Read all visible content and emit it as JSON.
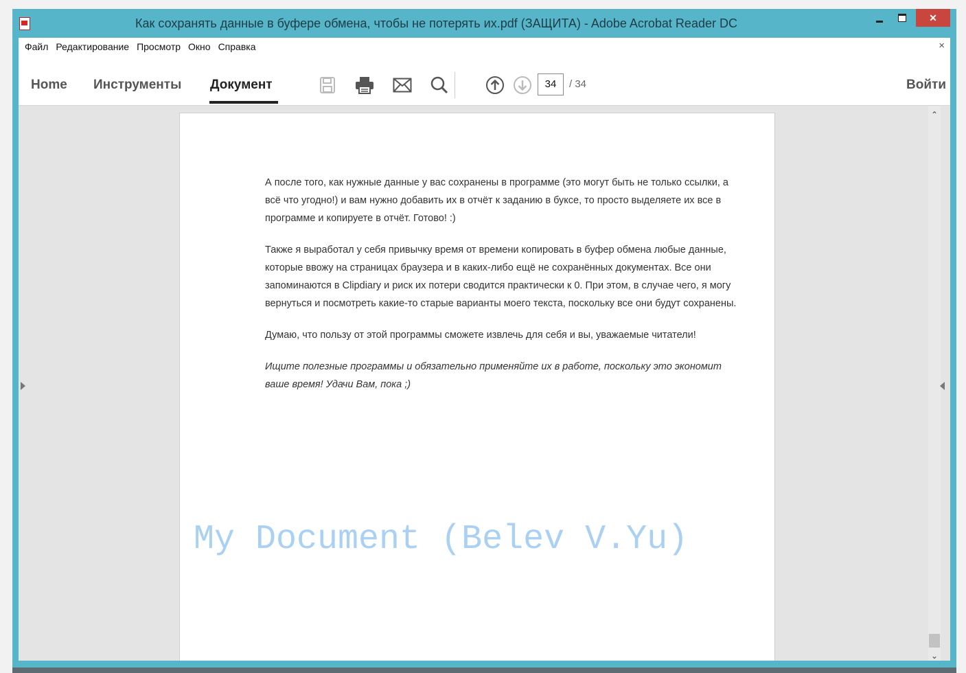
{
  "window": {
    "title": "Как сохранять данные в буфере обмена, чтобы не потерять их.pdf (ЗАЩИТА) - Adobe Acrobat Reader DC",
    "close_glyph": "✕"
  },
  "menu": {
    "items": [
      "Файл",
      "Редактирование",
      "Просмотр",
      "Окно",
      "Справка"
    ],
    "close_glyph": "×"
  },
  "toolbar": {
    "tabs": [
      "Home",
      "Инструменты",
      "Документ"
    ],
    "active_tab": "Документ",
    "tools": [
      "save-icon",
      "print-icon",
      "email-icon",
      "search-icon",
      "page-up-icon",
      "page-down-icon"
    ],
    "page_current": "34",
    "page_total": "/ 34",
    "login_label": "Войти"
  },
  "document": {
    "paragraphs": [
      "А после того, как нужные данные у вас сохранены в программе (это могут быть не только ссылки, а всё что угодно!) и вам нужно добавить их в отчёт к заданию в буксе, то просто выделяете их все в программе и копируете в отчёт. Готово! :)",
      "Также я выработал у себя привычку время от времени копировать в буфер обмена любые данные, которые ввожу на страницах браузера и в каких-либо ещё не сохранённых документах. Все они запоминаются в Clipdiary и риск их потери сводится практически к 0. При этом, в случае чего, я могу вернуться и посмотреть какие-то старые варианты моего текста, поскольку все они будут сохранены.",
      "Думаю, что пользу от этой программы сможете извлечь для себя и вы, уважаемые читатели!",
      "Ищите полезные программы и обязательно применяйте их в работе, поскольку это экономит ваше время! Удачи Вам, пока ;)"
    ],
    "watermark": "My Document (Belev V.Yu)"
  },
  "scroll": {
    "up_glyph": "⌃",
    "down_glyph": "⌄",
    "position": 0.98
  },
  "colors": {
    "frame": "#56b5c9",
    "close_button": "#c8463d",
    "watermark": "#aad0f4"
  }
}
